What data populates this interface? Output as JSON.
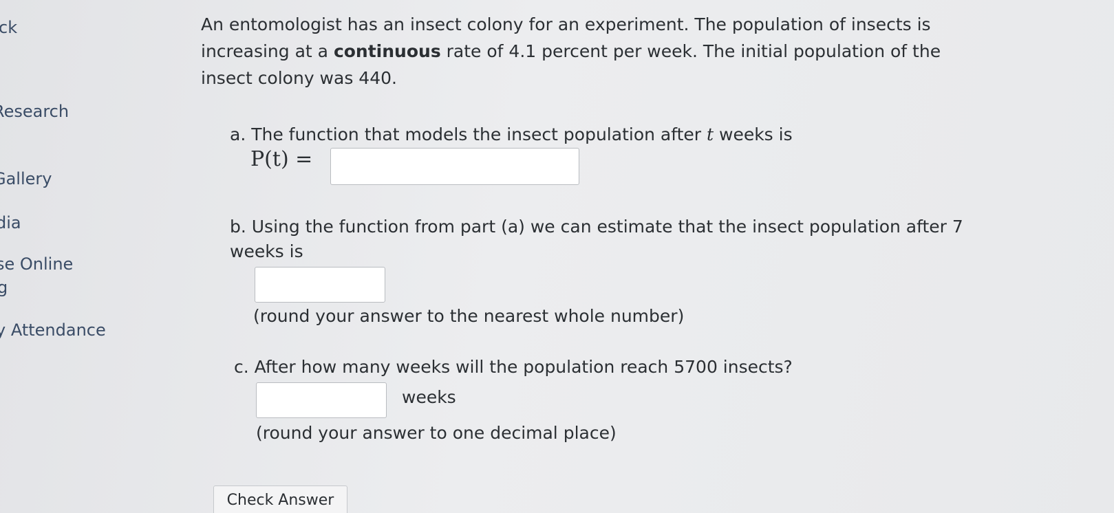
{
  "sidebar": {
    "items": [
      {
        "label": "ck"
      },
      {
        "label": "Research"
      },
      {
        "label": "Gallery"
      },
      {
        "label": "dia"
      },
      {
        "label": "se Online"
      },
      {
        "label": "g"
      },
      {
        "label": "y Attendance"
      }
    ]
  },
  "problem": {
    "intro_1": "An entomologist has an insect colony for an experiment. The population of insects is increasing at a ",
    "intro_bold": "continuous",
    "intro_2": " rate of 4.1 percent per week. The initial population of the insect colony was 440."
  },
  "part_a": {
    "text_1": "a. The function that models the insect population after ",
    "var": "t",
    "text_2": " weeks is",
    "math_label": "P(t) ="
  },
  "part_b": {
    "text": "b. Using the function from part (a) we can estimate that the insect population after 7 weeks is",
    "note": "(round your answer to the nearest whole number)"
  },
  "part_c": {
    "text": "c. After how many weeks will the population reach 5700 insects?",
    "unit": "weeks",
    "note": "(round your answer to one decimal place)"
  },
  "check_button": {
    "label": "Check Answer"
  }
}
